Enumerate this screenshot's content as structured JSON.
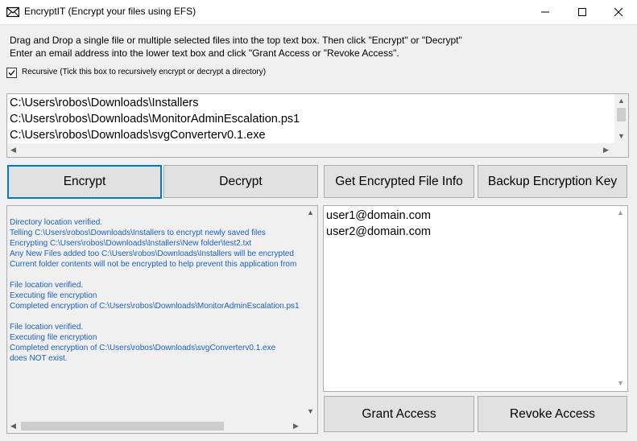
{
  "window": {
    "title": "EncryptIT (Encrypt your files using EFS)",
    "icon": "app-envelope-icon"
  },
  "instructions": {
    "line1": "Drag and Drop a single file or multiple selected files into the top text box. Then click \"Encrypt\" or \"Decrypt\"",
    "line2": "Enter an email address into the lower text box and click \"Grant Access or \"Revoke Access\"."
  },
  "recursive": {
    "checked": true,
    "label": "Recursive (Tick this box to recursively encrypt or decrypt a directory)"
  },
  "files": [
    "C:\\Users\\robos\\Downloads\\Installers",
    "C:\\Users\\robos\\Downloads\\MonitorAdminEscalation.ps1",
    "C:\\Users\\robos\\Downloads\\svgConverterv0.1.exe"
  ],
  "buttons": {
    "encrypt": "Encrypt",
    "decrypt": "Decrypt",
    "get_info": "Get Encrypted File Info",
    "backup_key": "Backup Encryption Key",
    "grant": "Grant Access",
    "revoke": "Revoke Access"
  },
  "log": [
    "Directory location verified.",
    "Telling C:\\Users\\robos\\Downloads\\Installers to encrypt newly saved files",
    "Encrypting C:\\Users\\robos\\Downloads\\Installers\\New folder\\test2.txt",
    "Any New Files added too C:\\Users\\robos\\Downloads\\Installers will be encrypted",
    "Current folder contents will not be encrypted to help prevent this application from",
    "",
    "File location verified.",
    "Executing file encryption",
    "Completed encryption of C:\\Users\\robos\\Downloads\\MonitorAdminEscalation.ps1",
    "",
    "File location verified.",
    "Executing file encryption",
    "Completed encryption of C:\\Users\\robos\\Downloads\\svgConverterv0.1.exe",
    " does NOT exist."
  ],
  "users": [
    "user1@domain.com",
    "user2@domain.com"
  ],
  "colors": {
    "accent": "#0078d7",
    "log_text": "#1b5fc9"
  }
}
